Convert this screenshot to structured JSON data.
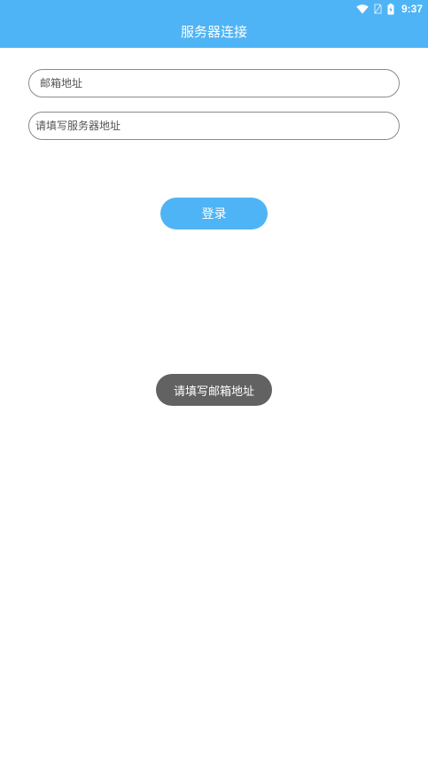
{
  "status_bar": {
    "time": "9:37",
    "icons": [
      "wifi-icon",
      "no-sim-icon",
      "battery-charging-icon"
    ]
  },
  "header": {
    "title": "服务器连接"
  },
  "form": {
    "email": {
      "value": "",
      "placeholder": "邮箱地址"
    },
    "server": {
      "value": "",
      "placeholder": "请填写服务器地址"
    },
    "login_label": "登录"
  },
  "toast": {
    "message": "请填写邮箱地址"
  },
  "colors": {
    "accent": "#4fb4f5",
    "toast_bg": "#626262",
    "field_border": "#8a8a8a",
    "background": "#ffffff"
  }
}
